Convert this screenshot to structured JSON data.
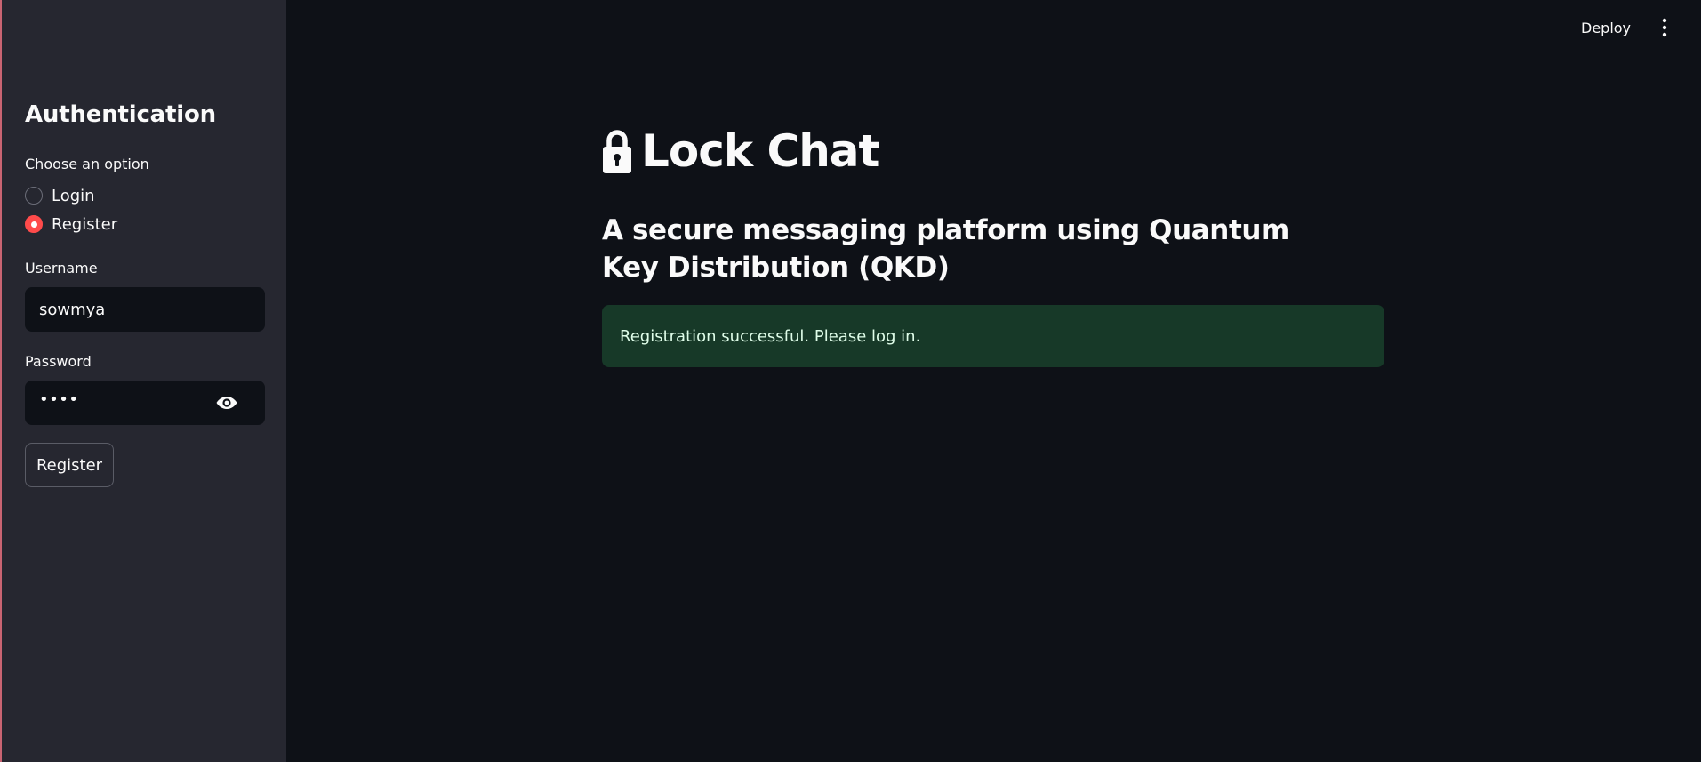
{
  "header": {
    "deploy_label": "Deploy",
    "menu_icon": "vertical-dots-icon"
  },
  "sidebar": {
    "title": "Authentication",
    "option_label": "Choose an option",
    "options": [
      {
        "label": "Login",
        "selected": false
      },
      {
        "label": "Register",
        "selected": true
      }
    ],
    "username": {
      "label": "Username",
      "value": "sowmya"
    },
    "password": {
      "label": "Password",
      "masked_value": "••••",
      "toggle_icon": "eye-icon"
    },
    "submit_label": "Register"
  },
  "main": {
    "title_icon": "lock-icon",
    "title": "Lock Chat",
    "subtitle": "A secure messaging platform using Quantum Key Distribution (QKD)",
    "alert": {
      "type": "success",
      "text": "Registration successful. Please log in."
    }
  },
  "colors": {
    "background": "#0e1117",
    "sidebar": "#262730",
    "accent": "#ff4b4b",
    "success_bg": "#173928",
    "success_text": "#dffde9"
  }
}
